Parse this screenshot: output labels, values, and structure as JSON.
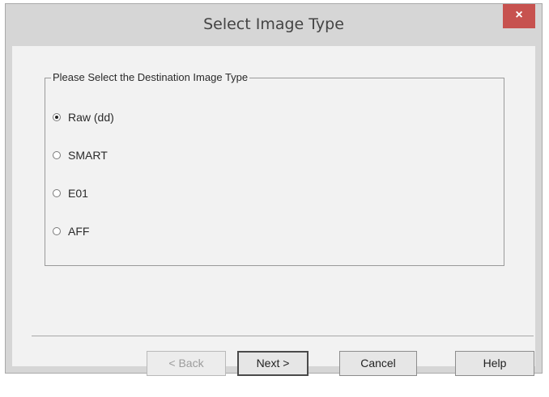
{
  "dialog": {
    "title": "Select Image Type",
    "close_glyph": "×"
  },
  "group": {
    "legend": "Please Select the Destination Image Type",
    "options": [
      {
        "label": "Raw (dd)",
        "selected": true
      },
      {
        "label": "SMART",
        "selected": false
      },
      {
        "label": "E01",
        "selected": false
      },
      {
        "label": "AFF",
        "selected": false
      }
    ]
  },
  "buttons": {
    "back": "< Back",
    "next": "Next >",
    "cancel": "Cancel",
    "help": "Help"
  },
  "icons": {
    "close": "close-icon"
  },
  "colors": {
    "close_button_bg": "#c7524f",
    "dialog_body_bg": "#f2f2f2",
    "window_frame_bg": "#d6d6d6"
  }
}
